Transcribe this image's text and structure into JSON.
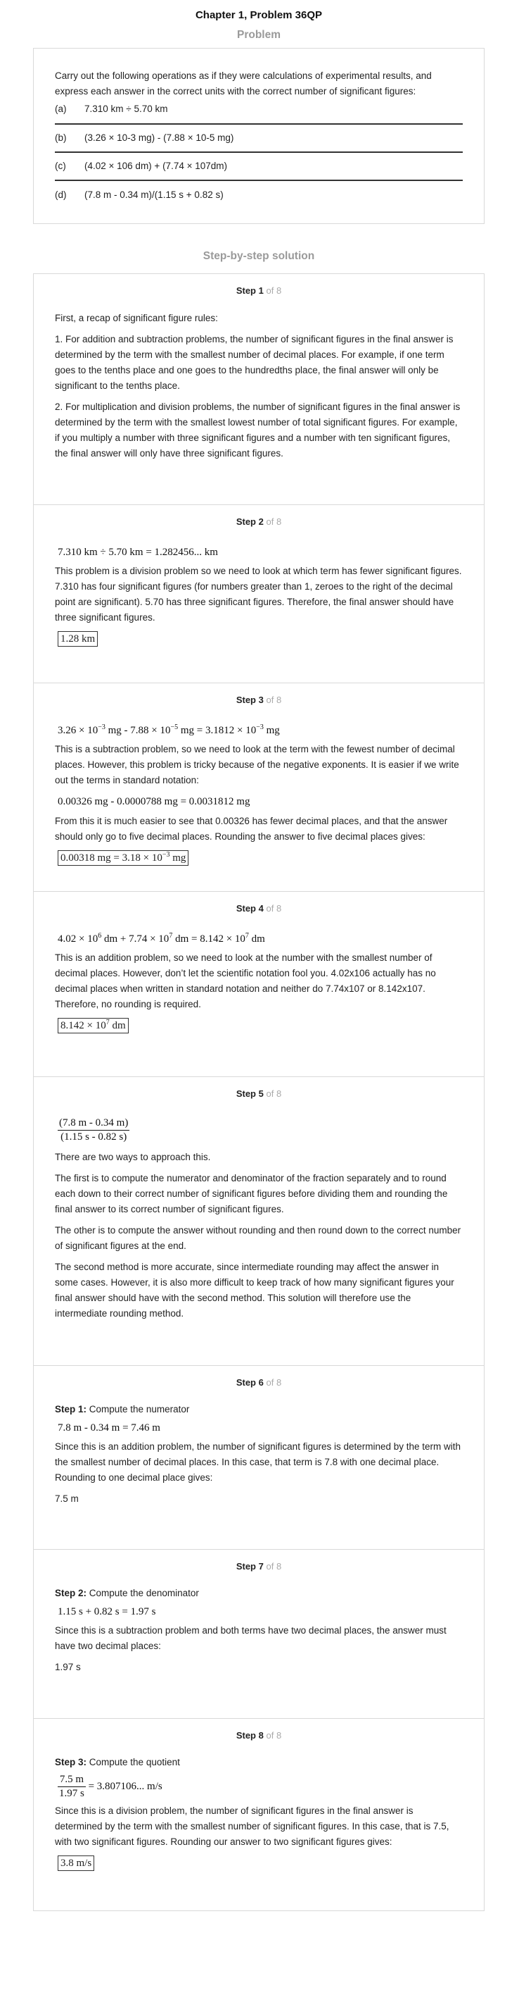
{
  "title": "Chapter 1, Problem 36QP",
  "problem_heading": "Problem",
  "problem": {
    "intro": "Carry out the following operations as if they were calculations of experimental results, and express each answer in the correct units with the correct number of significant figures:",
    "items": [
      {
        "label": "(a)",
        "text": "7.310 km ÷ 5.70 km"
      },
      {
        "label": "(b)",
        "text": "(3.26 × 10-3 mg) - (7.88 × 10-5 mg)"
      },
      {
        "label": "(c)",
        "text": "(4.02 × 106 dm) + (7.74 × 107dm)"
      },
      {
        "label": "(d)",
        "text": "(7.8 m - 0.34 m)/(1.15 s + 0.82 s)"
      }
    ]
  },
  "solution_heading": "Step-by-step solution",
  "step_word": "Step",
  "step_of": "of 8",
  "steps": {
    "s1": {
      "num": "1",
      "p1": "First, a recap of significant figure rules:",
      "p2": "1. For addition and subtraction problems, the number of significant figures in the final answer is determined by the term with the smallest number of decimal places. For example, if one term goes to the tenths place and one goes to the hundredths place, the final answer will only be significant to the tenths place.",
      "p3": "2. For multiplication and division problems, the number of significant figures in the final answer is determined by the term with the smallest lowest number of total significant figures. For example, if you multiply a number with three significant figures and a number with ten significant figures, the final answer will only have three significant figures."
    },
    "s2": {
      "num": "2",
      "eq": "7.310 km  ÷  5.70 km = 1.282456... km",
      "p1": "This problem is a division problem so we need to look at which term has fewer significant figures. 7.310 has four significant figures (for numbers greater than 1, zeroes to the right of the decimal point are significant). 5.70 has three significant figures. Therefore, the final answer should have three significant figures.",
      "answer": "1.28 km"
    },
    "s3": {
      "num": "3",
      "eq_a": "3.26 × 10",
      "eq_a_exp": "−3",
      "eq_b": " mg - 7.88 × 10",
      "eq_b_exp": "−5",
      "eq_c": " mg = 3.1812 × 10",
      "eq_c_exp": "−3",
      "eq_d": " mg",
      "p1": "This is a subtraction problem, so we need to look at the term with the fewest number of decimal places. However, this problem is tricky because of the negative exponents. It is easier if we write out the terms in standard notation:",
      "eq2": "0.00326 mg - 0.0000788 mg = 0.0031812 mg",
      "p2": "From this it is much easier to see that 0.00326 has fewer decimal places, and that the answer should only go to five decimal places. Rounding the answer to five decimal places gives:",
      "ans_a": "0.00318 mg = 3.18 × 10",
      "ans_exp": "−3",
      "ans_b": " mg"
    },
    "s4": {
      "num": "4",
      "eq_a": "4.02 × 10",
      "eq_a_exp": "6",
      "eq_b": " dm + 7.74 × 10",
      "eq_b_exp": "7",
      "eq_c": " dm = 8.142 × 10",
      "eq_c_exp": "7",
      "eq_d": " dm",
      "p1": "This is an addition problem, so we need to look at the number with the smallest number of decimal places. However, don’t let the scientific notation fool you. 4.02x106 actually has no decimal places when written in standard notation and neither do 7.74x107 or 8.142x107. Therefore, no rounding is required.",
      "ans_a": "8.142 × 10",
      "ans_exp": "7",
      "ans_b": " dm"
    },
    "s5": {
      "num": "5",
      "frac_num": "7.8 m - 0.34 m",
      "frac_den": "1.15 s - 0.82 s",
      "p1": "There are two ways to approach this.",
      "p2": "The first is to compute the numerator and denominator of the fraction separately and to round each down to their correct number of significant figures before dividing them and rounding the final answer to its correct number of significant figures.",
      "p3": "The other is to compute the answer without rounding and then round down to the correct number of significant figures at the end.",
      "p4": "The second method is more accurate, since intermediate rounding may affect the answer in some cases. However, it is also more difficult to keep track of how many significant figures your final answer should have with the second method. This solution will therefore use the intermediate rounding method."
    },
    "s6": {
      "num": "6",
      "sub_bold": "Step 1:",
      "sub_text": " Compute the numerator",
      "eq": "7.8 m - 0.34 m = 7.46 m",
      "p1": "Since this is an addition problem, the number of significant figures is determined by the term with the smallest number of decimal places. In this case, that term is 7.8 with one decimal place. Rounding to one decimal place gives:",
      "result": "7.5 m"
    },
    "s7": {
      "num": "7",
      "sub_bold": "Step 2:",
      "sub_text": " Compute the denominator",
      "eq": "1.15 s + 0.82 s = 1.97 s",
      "p1": "Since this is a subtraction problem and both terms have two decimal places, the answer must have two decimal places:",
      "result": "1.97 s"
    },
    "s8": {
      "num": "8",
      "sub_bold": "Step 3:",
      "sub_text": " Compute the quotient",
      "frac_num": "7.5 m",
      "frac_den": "1.97 s",
      "eq_rest": " = 3.807106... m/s",
      "p1": "Since this is a division problem, the number of significant figures in the final answer is determined by the term with the smallest number of significant figures. In this case, that is 7.5, with two significant figures. Rounding our answer to two significant figures gives:",
      "answer": "3.8 m/s"
    }
  }
}
